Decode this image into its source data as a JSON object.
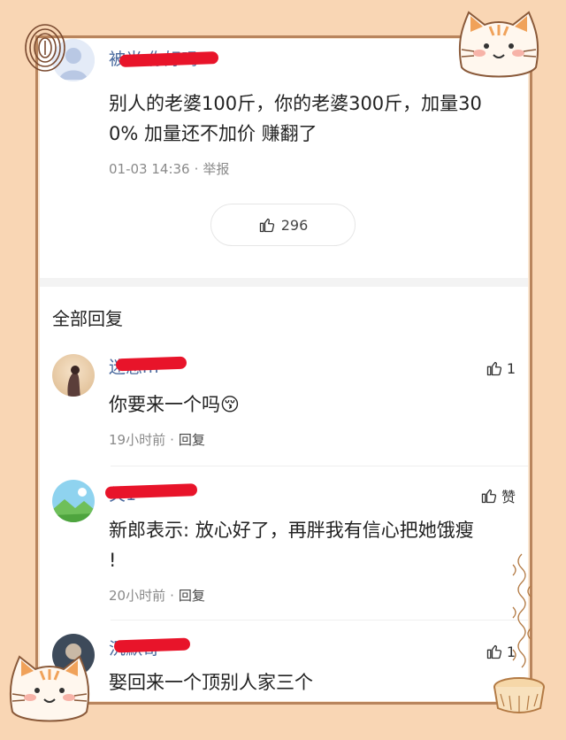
{
  "top_comment": {
    "username": "被光 你好吗",
    "text_line1": "别人的老婆100斤，你的老婆300斤，加量30",
    "text_line2": "0% 加量还不加价 赚翻了",
    "time": "01-03 14:36",
    "report": "举报",
    "likes": "296"
  },
  "replies_header": "全部回复",
  "replies": [
    {
      "username": "迷恋m",
      "text": "你要来一个吗",
      "emoji": "😚",
      "time": "19小时前",
      "reply_label": "回复",
      "likes": "1"
    },
    {
      "username": "关1",
      "text_line1": "新郎表示: 放心好了，再胖我有信心把她饿瘦",
      "text_line2": "!",
      "time": "20小时前",
      "reply_label": "回复",
      "likes": "赞"
    },
    {
      "username": "沉默哥",
      "text": "娶回来一个顶别人家三个",
      "likes": "1"
    }
  ],
  "colors": {
    "background": "#f9d6b4",
    "frame": "#b9855d",
    "username": "#4a6a9e",
    "redaction": "#e8142a",
    "meta": "#8a8a8a"
  }
}
